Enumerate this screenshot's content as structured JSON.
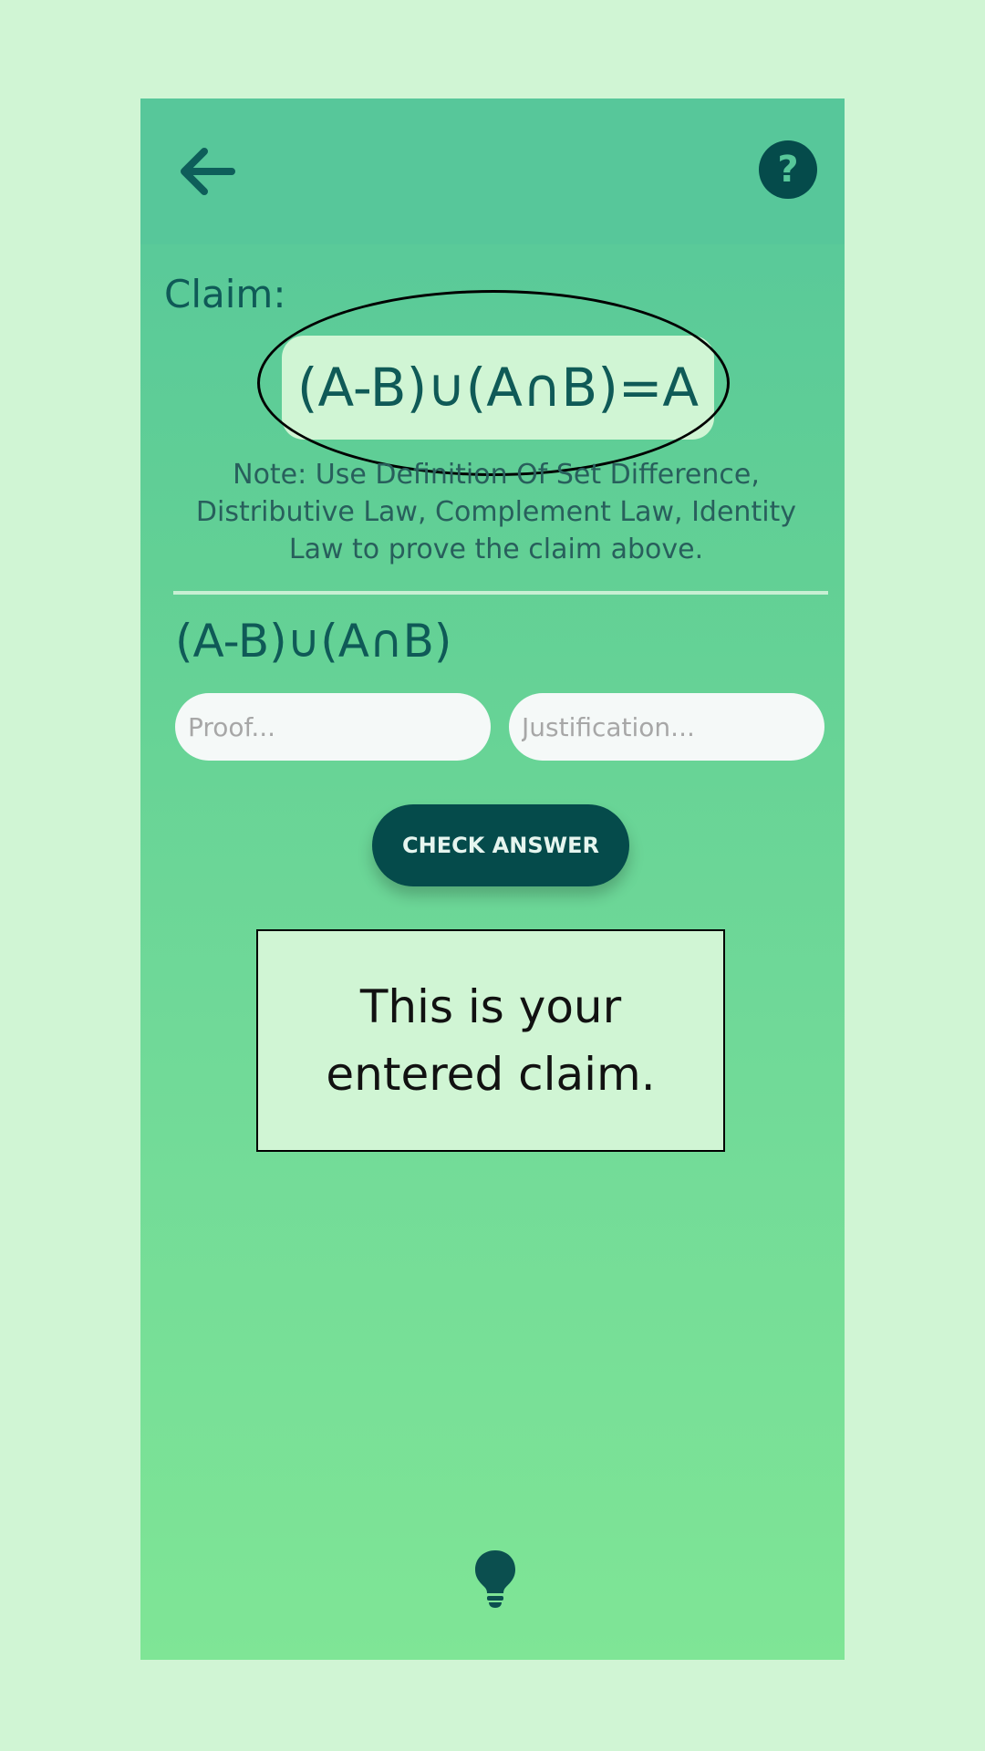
{
  "header": {
    "back_icon": "arrow-left-icon",
    "help_icon": "question-mark-icon",
    "help_glyph": "?"
  },
  "claim": {
    "label": "Claim:",
    "expression": "(A-B)∪(A∩B)=A",
    "note": "Note: Use Definition Of Set Difference, Distributive Law, Complement Law, Identity Law to prove the claim above."
  },
  "step": {
    "expression": "(A-B)∪(A∩B)",
    "proof_placeholder": "Proof...",
    "justification_placeholder": "Justification..."
  },
  "actions": {
    "check_label": "CHECK ANSWER"
  },
  "tooltip": {
    "text": "This is your entered claim."
  },
  "footer": {
    "hint_icon": "lightbulb-icon"
  },
  "colors": {
    "page_background": "#d0f5d4",
    "dark_teal": "#054b4b",
    "header_green": "#57c79a",
    "text_teal": "#0f5a57"
  }
}
